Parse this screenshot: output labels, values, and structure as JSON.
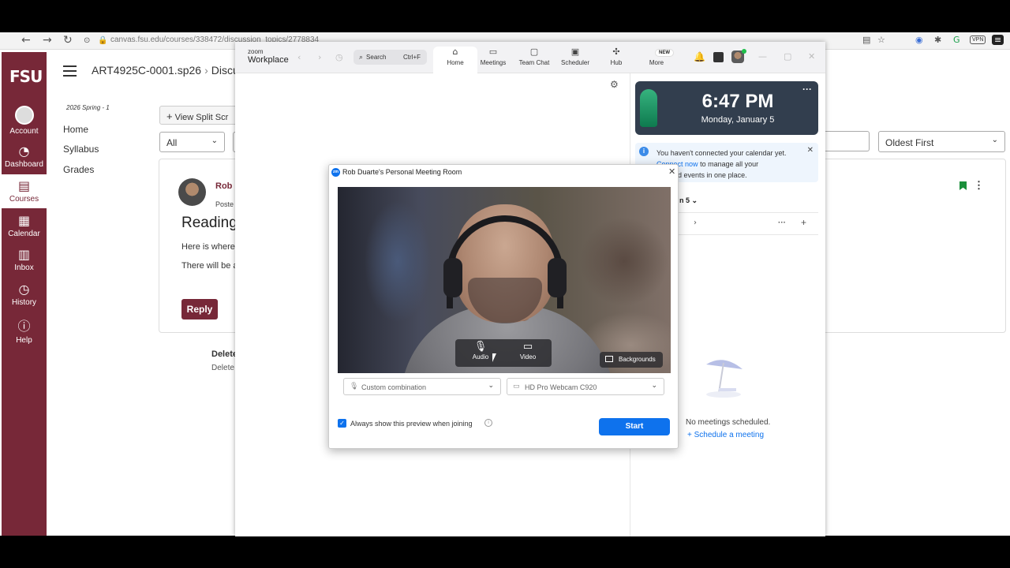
{
  "browser": {
    "url": "canvas.fsu.edu/courses/338472/discussion_topics/2778834",
    "vpn_badge": "VPN"
  },
  "canvas": {
    "logo": "FSU",
    "global_nav": [
      {
        "label": "Account",
        "icon": "account-avatar"
      },
      {
        "label": "Dashboard",
        "icon": "dashboard-icon"
      },
      {
        "label": "Courses",
        "icon": "courses-icon"
      },
      {
        "label": "Calendar",
        "icon": "calendar-icon"
      },
      {
        "label": "Inbox",
        "icon": "inbox-icon"
      },
      {
        "label": "History",
        "icon": "history-icon"
      },
      {
        "label": "Help",
        "icon": "help-icon"
      }
    ],
    "active_color": "#772838",
    "breadcrumb": {
      "course": "ART4925C-0001.sp26",
      "separator": "›",
      "current": "Discuss"
    },
    "term": "2026 Spring - 1",
    "course_nav": [
      "Home",
      "Syllabus",
      "Grades"
    ],
    "view_split_label": "View Split Scr",
    "filter_value": "All",
    "sort_value": "Oldest First",
    "post": {
      "author": "Rob I",
      "meta": "Poste",
      "title": "Reading",
      "line1": "Here is where",
      "line2": "There will be a",
      "reply_label": "Reply"
    },
    "deleted": {
      "title": "Delete",
      "subtitle": "Delete"
    }
  },
  "zoom": {
    "logo_small": "zoom",
    "logo_big": "Workplace",
    "search_placeholder": "Search",
    "search_shortcut": "Ctrl+F",
    "tabs": [
      {
        "label": "Home",
        "icon": "home-icon"
      },
      {
        "label": "Meetings",
        "icon": "meetings-icon"
      },
      {
        "label": "Team Chat",
        "icon": "team-chat-icon"
      },
      {
        "label": "Scheduler",
        "icon": "scheduler-icon"
      },
      {
        "label": "Hub",
        "icon": "hub-icon"
      },
      {
        "label": "More",
        "icon": "more-icon"
      }
    ],
    "new_badge": "NEW",
    "clock": {
      "time": "6:47 PM",
      "date": "Monday, January 5"
    },
    "calendar_notice": {
      "text_before": "You haven't connected your calendar yet.",
      "link": "Connect now",
      "text_after": "to manage all your",
      "text_line3": "ngs and events in one place."
    },
    "calendar_date_label": "n 5",
    "no_meetings": "No meetings scheduled.",
    "schedule_link": "+ Schedule a meeting",
    "accent_color": "#0e72ed"
  },
  "preview": {
    "title": "Rob Duarte's Personal Meeting Room",
    "audio_label": "Audio",
    "video_label": "Video",
    "backgrounds_label": "Backgrounds",
    "mic_select": "Custom combination",
    "camera_select": "HD Pro Webcam C920",
    "always_show_label": "Always show this preview when joining",
    "always_show_checked": true,
    "start_label": "Start"
  }
}
